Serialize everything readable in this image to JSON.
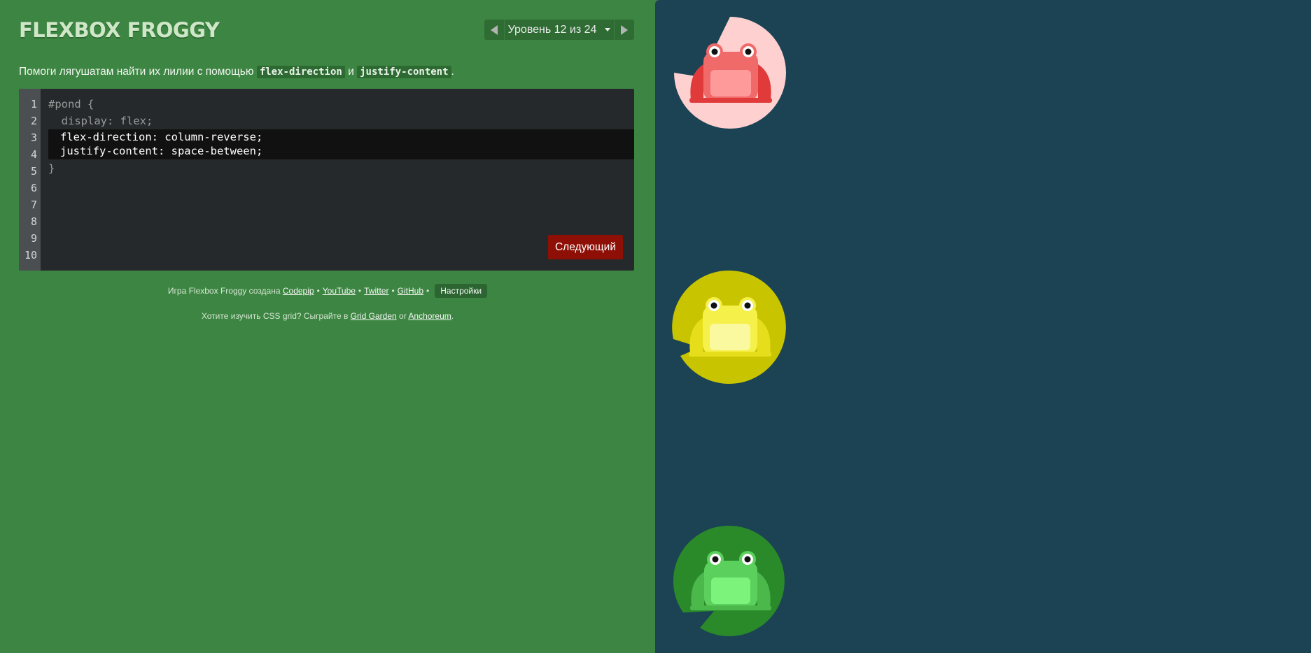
{
  "app": {
    "title": "FLEXBOX FROGGY"
  },
  "level_nav": {
    "label": "Уровень 12 из 24",
    "prev_icon": "arrow-left-icon",
    "next_icon": "arrow-right-icon"
  },
  "instructions": {
    "prefix": "Помоги лягушатам найти их лилии с помощью ",
    "code1": "flex-direction",
    "middle": " и ",
    "code2": "justify-content",
    "suffix": "."
  },
  "editor": {
    "line_numbers": [
      "1",
      "2",
      "3",
      "4",
      "5",
      "6",
      "7",
      "8",
      "9",
      "10"
    ],
    "line1": "#pond {",
    "line2": "  display: flex;",
    "input_value": "flex-direction: column-reverse;\njustify-content: space-between;",
    "line5": "}",
    "next_button": "Следующий"
  },
  "credits": {
    "prefix": "Игра Flexbox Froggy создана ",
    "links": [
      "Codepip",
      "YouTube",
      "Twitter",
      "GitHub"
    ],
    "separator": "•",
    "settings": "Настройки"
  },
  "promo": {
    "prefix": "Хотите изучить CSS grid? Сыграйте в ",
    "link1": "Grid Garden",
    "or": " or ",
    "link2": "Anchoreum",
    "suffix": "."
  },
  "pond": {
    "frogs": [
      {
        "color": "red",
        "pad_color": "#ffd6d6",
        "frog_color": "#f06a6a"
      },
      {
        "color": "yellow",
        "pad_color": "#d9d400",
        "frog_color": "#f6f04a"
      },
      {
        "color": "green",
        "pad_color": "#2f8f2f",
        "frog_color": "#5cd05c"
      }
    ]
  },
  "colors": {
    "sidebar_bg": "#3d8542",
    "pond_bg": "#1c4354",
    "editor_bg": "#26292c",
    "next_button_bg": "#8e0f06"
  }
}
